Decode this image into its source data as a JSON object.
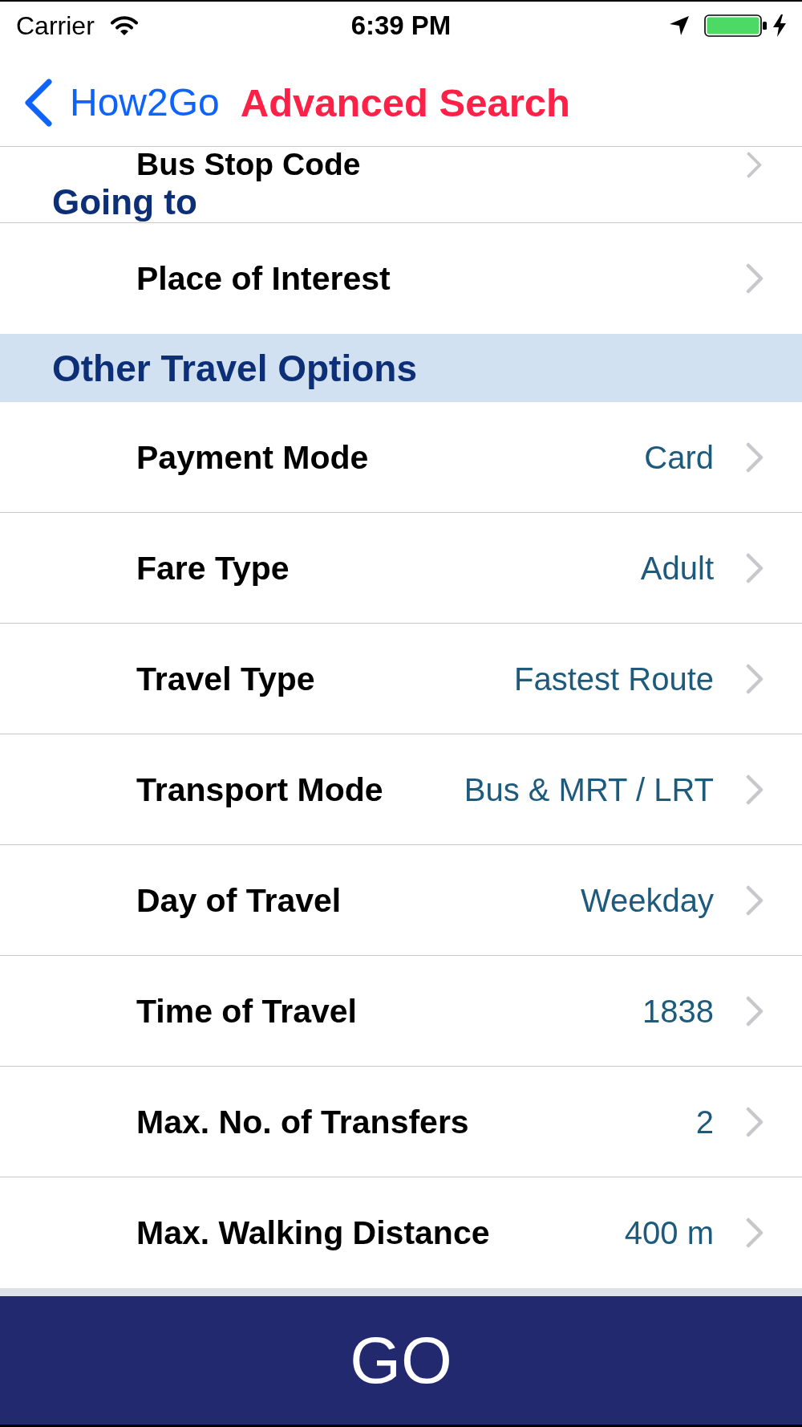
{
  "status_bar": {
    "carrier": "Carrier",
    "time": "6:39 PM"
  },
  "nav_bar": {
    "back_label": "How2Go",
    "title": "Advanced Search"
  },
  "list": [
    {
      "kind": "clipped_row",
      "label": "Bus Stop Code"
    },
    {
      "kind": "pinned_header",
      "label": "Going to"
    },
    {
      "kind": "row",
      "label": "Place of Interest"
    },
    {
      "kind": "header",
      "label": "Other Travel Options"
    },
    {
      "kind": "row",
      "label": "Payment Mode",
      "value": "Card"
    },
    {
      "kind": "row",
      "label": "Fare Type",
      "value": "Adult"
    },
    {
      "kind": "row",
      "label": "Travel Type",
      "value": "Fastest Route"
    },
    {
      "kind": "row",
      "label": "Transport Mode",
      "value": "Bus & MRT / LRT"
    },
    {
      "kind": "row",
      "label": "Day of Travel",
      "value": "Weekday"
    },
    {
      "kind": "row",
      "label": "Time of Travel",
      "value": "1838"
    },
    {
      "kind": "row",
      "label": "Max. No. of Transfers",
      "value": "2"
    },
    {
      "kind": "row",
      "label": "Max. Walking Distance",
      "value": "400 m"
    }
  ],
  "go_button": {
    "label": "GO"
  }
}
